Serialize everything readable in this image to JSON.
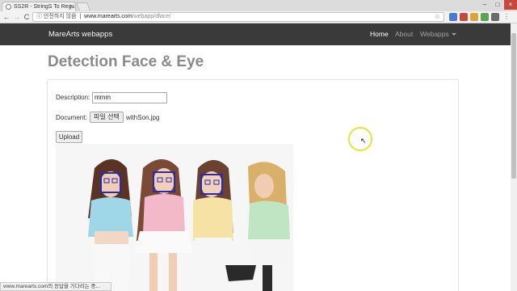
{
  "browser": {
    "tab_title": "SS2R - StringS To Regu",
    "close_glyph": "×",
    "address": {
      "secure_label": "ⓘ 안전하지 않음",
      "host": "www.marearts.com",
      "path": "/webapp/dface/"
    },
    "nav_glyphs": {
      "back": "←",
      "forward": "→",
      "reload": "C"
    },
    "star_glyph": "☆",
    "window_controls": {
      "minimize": "–",
      "maximize": "□",
      "close": "×"
    },
    "status_text": "www.marearts.com의 응답을 기다리는 중..."
  },
  "navbar": {
    "brand": "MareArts webapps",
    "links": [
      {
        "label": "Home",
        "active": true
      },
      {
        "label": "About",
        "active": false
      },
      {
        "label": "Webapps",
        "active": false
      }
    ]
  },
  "page": {
    "title": "Detection Face & Eye",
    "form": {
      "description_label": "Description:",
      "description_value": "mmm",
      "document_label": "Document:",
      "file_button": "파일 선택",
      "file_name": "withSon.jpg",
      "upload_button": "Upload"
    }
  },
  "colors": {
    "navbar_bg": "#3a3a3a",
    "title": "#8a8a8a",
    "detection_box": "#2a2ab0",
    "cursor_highlight": "#e6e23a"
  }
}
